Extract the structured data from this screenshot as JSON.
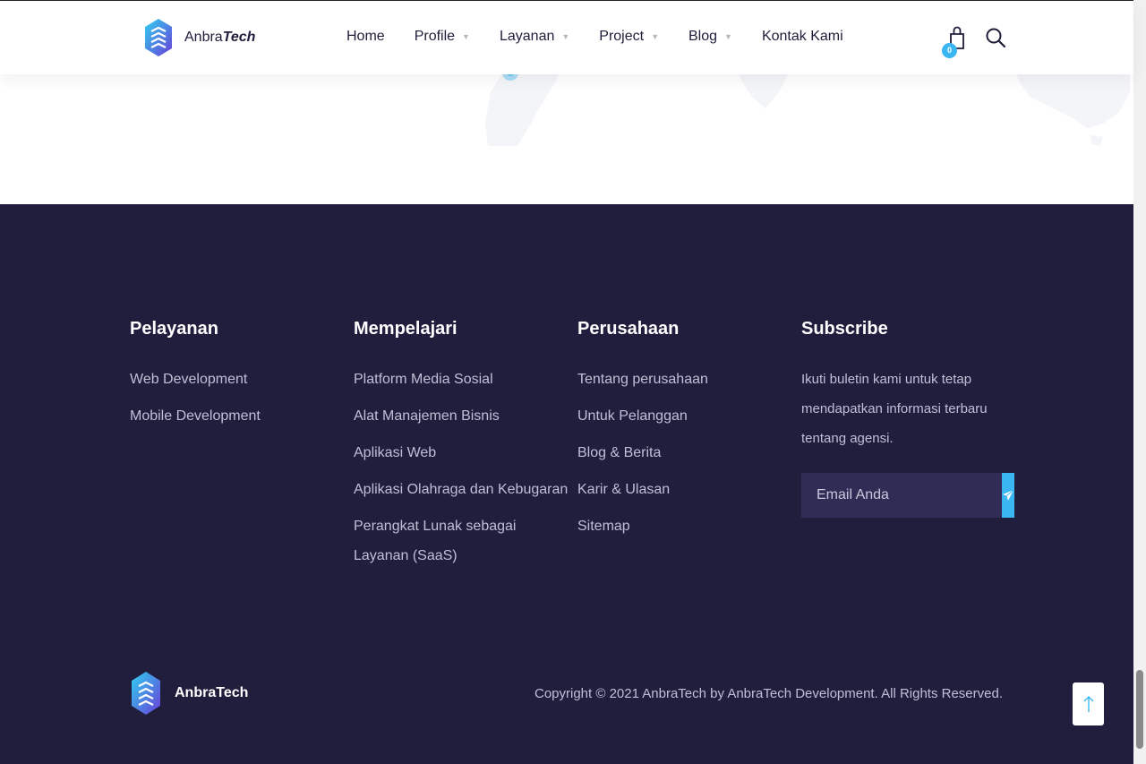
{
  "header": {
    "brand_prefix": "Anbra",
    "brand_suffix": "Tech",
    "nav": [
      {
        "label": "Home",
        "has_dropdown": false
      },
      {
        "label": "Profile",
        "has_dropdown": true
      },
      {
        "label": "Layanan",
        "has_dropdown": true
      },
      {
        "label": "Project",
        "has_dropdown": true
      },
      {
        "label": "Blog",
        "has_dropdown": true
      },
      {
        "label": "Kontak Kami",
        "has_dropdown": false
      }
    ],
    "caret": "▼",
    "cart_count": "0",
    "icons": [
      "shopping-bag-icon",
      "search-icon"
    ]
  },
  "footer": {
    "columns": [
      {
        "title": "Pelayanan",
        "links": [
          "Web Development",
          "Mobile Development"
        ]
      },
      {
        "title": "Mempelajari",
        "links": [
          "Platform Media Sosial",
          "Alat Manajemen Bisnis",
          "Aplikasi Web",
          "Aplikasi Olahraga dan Kebugaran",
          "Perangkat Lunak sebagai Layanan (SaaS)"
        ]
      },
      {
        "title": "Perusahaan",
        "links": [
          "Tentang perusahaan",
          "Untuk Pelanggan",
          "Blog & Berita",
          "Karir & Ulasan",
          "Sitemap"
        ]
      }
    ],
    "subscribe": {
      "title": "Subscribe",
      "text": "Ikuti buletin kami untuk tetap mendapatkan informasi terbaru tentang agensi.",
      "placeholder": "Email Anda",
      "button_icon": "paper-plane-icon"
    },
    "brand": "AnbraTech",
    "copyright": "Copyright © 2021 AnbraTech by AnbraTech Development. All Rights Reserved.",
    "to_top_icon": "arrow-up-icon"
  },
  "colors": {
    "footer_bg": "#201d3d",
    "accent": "#3ab6f2",
    "input_bg": "#302c55",
    "link": "#bfc0d6"
  }
}
